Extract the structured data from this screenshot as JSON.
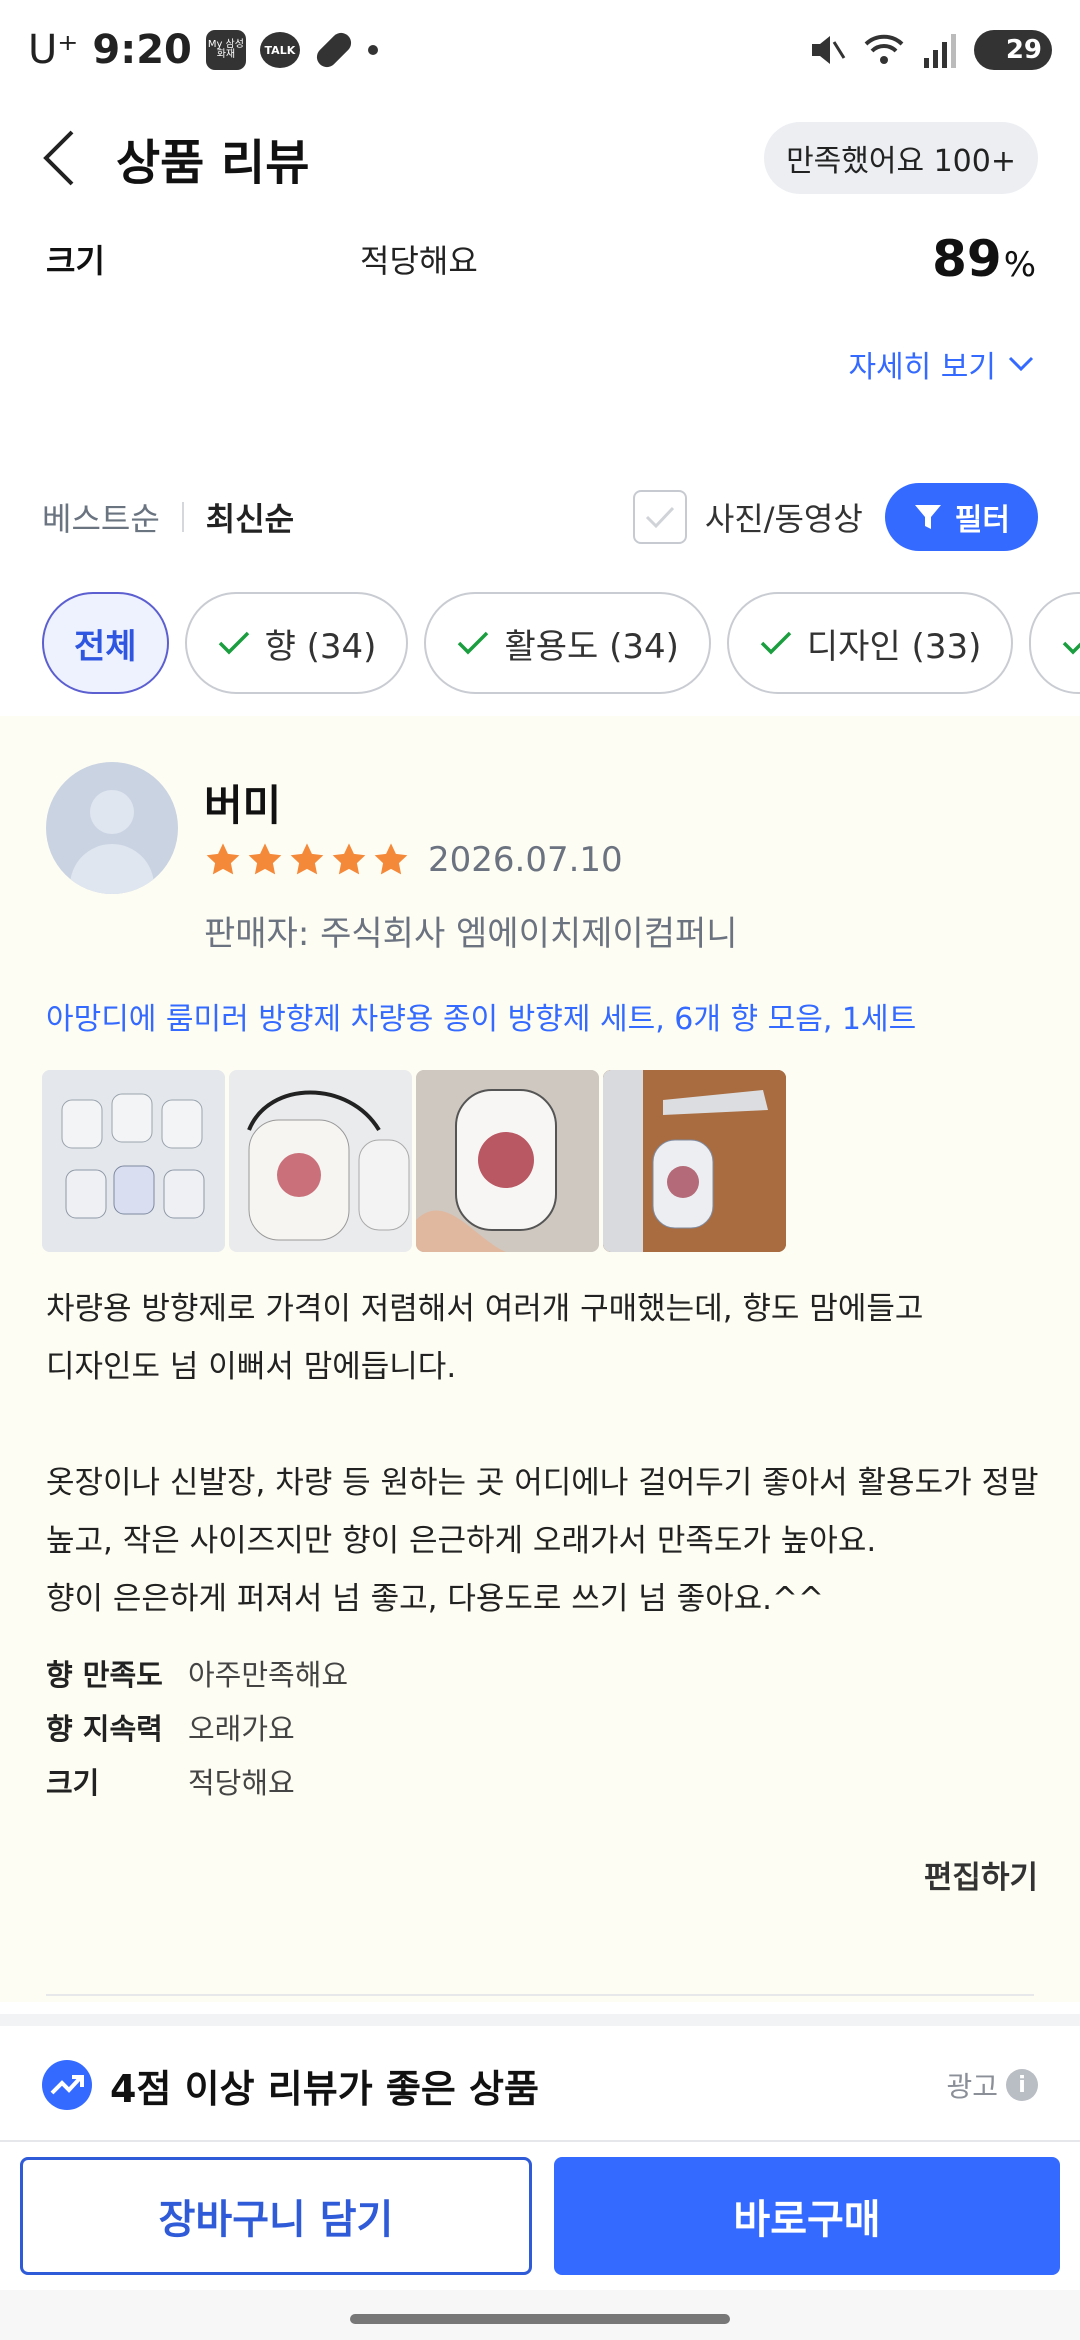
{
  "status_bar": {
    "carrier": "U⁺",
    "time": "9:20",
    "app_badge_label": "My 삼성화재",
    "talk_label": "TALK",
    "battery": "29"
  },
  "header": {
    "title": "상품 리뷰",
    "satisfied_badge": "만족했어요 100+"
  },
  "size_summary": {
    "label": "크기",
    "value": "적당해요",
    "percent": "89",
    "percent_unit": "%"
  },
  "detail_link": "자세히 보기",
  "sort": {
    "best": "베스트순",
    "newest": "최신순",
    "photo_video": "사진/동영상",
    "filter": "필터"
  },
  "chips": [
    {
      "label": "전체",
      "active": true
    },
    {
      "label": "향 (34)",
      "active": false
    },
    {
      "label": "활용도 (34)",
      "active": false
    },
    {
      "label": "디자인 (33)",
      "active": false
    }
  ],
  "review": {
    "name": "버미",
    "rating": 5,
    "date": "2026.07.10",
    "seller": "판매자: 주식회사 엠에이치제이컴퍼니",
    "product": "아망디에 룸미러 방향제 차량용 종이 방향제 세트, 6개 향 모음, 1세트",
    "text_lines": [
      "차량용 방향제로 가격이 저렴해서 여러개 구매했는데, 향도 맘에들고",
      "디자인도 넘 이뻐서 맘에듭니다.",
      "옷장이나 신발장, 차량 등 원하는 곳 어디에나 걸어두기 좋아서 활용도가 정말",
      "높고, 작은 사이즈지만 향이 은근하게 오래가서 만족도가 높아요.",
      "향이 은은하게 퍼져서 넘 좋고, 다용도로 쓰기 넘 좋아요.^^"
    ],
    "attributes": [
      {
        "label": "향 만족도",
        "value": "아주만족해요"
      },
      {
        "label": "향 지속력",
        "value": "오래가요"
      },
      {
        "label": "크기",
        "value": "적당해요"
      }
    ],
    "edit": "편집하기"
  },
  "recommend": {
    "title": "4점 이상 리뷰가 좋은 상품",
    "ad": "광고"
  },
  "bottom_bar": {
    "cart": "장바구니 담기",
    "buy": "바로구매"
  },
  "colors": {
    "accent": "#346aff",
    "star": "#f5893a",
    "review_bg": "#fefdf3"
  }
}
